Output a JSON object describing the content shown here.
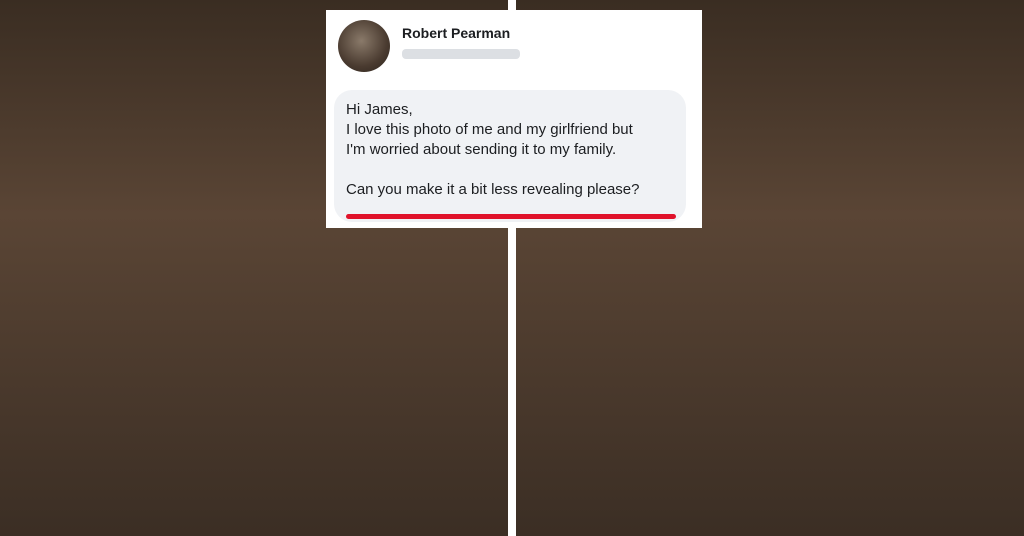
{
  "message": {
    "sender_name": "Robert Pearman",
    "lines": [
      "Hi James,",
      "I love this photo of me and my girlfriend but",
      "I'm worried about sending it to my family.",
      "Can you make it a bit less revealing please?"
    ],
    "highlight_color": "#e0122a"
  }
}
